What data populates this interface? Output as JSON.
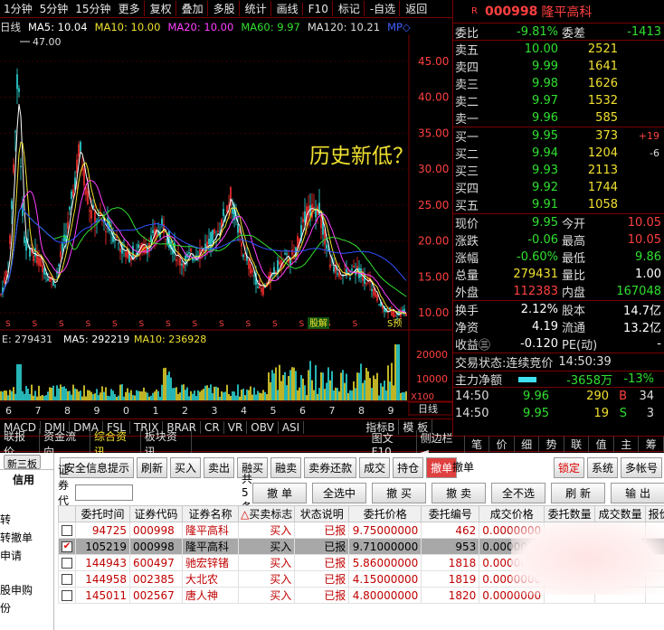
{
  "toolbar": {
    "items": [
      "1分钟",
      "5分钟",
      "15分钟",
      "更多",
      "复权",
      "叠加",
      "多股",
      "统计",
      "画线",
      "F10",
      "标记",
      "-自选",
      "返回"
    ]
  },
  "ma_bar": {
    "period": "日线",
    "ma5": "MA5: 10.04",
    "ma10": "MA10: 10.00",
    "ma20": "MA20: 10.00",
    "ma60": "MA60: 9.97",
    "ma120": "MA120: 10.21",
    "mp": "MP◇"
  },
  "chart": {
    "high_label": "47.00",
    "price_ticks": [
      "45.00",
      "40.00",
      "35.00",
      "30.00",
      "25.00",
      "20.00",
      "15.00",
      "10.00"
    ],
    "annotation": "历史新低？",
    "event_label_1": "股解",
    "event_label_2": "S预",
    "volume_readout": {
      "vol": "E: 279431",
      "ma5": "MA5: 292219",
      "ma10": "MA10: 236928"
    },
    "volume_ticks": [
      "20000",
      "10000"
    ],
    "volume_unit": "X100",
    "x_ticks": [
      "6",
      "7",
      "8",
      "9",
      "0",
      "1",
      "2",
      "3",
      "4",
      "5",
      "6",
      "7",
      "8",
      "9"
    ],
    "period_button": "日线",
    "colors": {
      "up": "#ff3030",
      "down": "#30e0e0",
      "ma5": "#ffffff",
      "ma10": "#f0e030",
      "ma20": "#ff40ff",
      "ma60": "#30e030",
      "ma120": "#40a0ff"
    }
  },
  "indicator_tabs": [
    "MACD",
    "DMI",
    "DMA",
    "FSL",
    "TRIX",
    "BRAR",
    "CR",
    "VR",
    "OBV",
    "ASI",
    "指标B",
    "模 板"
  ],
  "info_tabs": [
    "联报价",
    "资金流向",
    "综合资讯",
    "板块资讯",
    "图文F10",
    "侧边栏◄",
    "笔",
    "价",
    "细",
    "势",
    "联",
    "值",
    "主",
    "筹"
  ],
  "quote": {
    "flag": "R",
    "code": "000998",
    "name": "隆平高科",
    "webi_label": "委比",
    "webi": "-9.81%",
    "weicha_label": "委差",
    "weicha": "-1413",
    "asks": [
      {
        "label": "卖五",
        "price": "10.00",
        "vol": "2521",
        "chg": ""
      },
      {
        "label": "卖四",
        "price": "9.99",
        "vol": "1641",
        "chg": ""
      },
      {
        "label": "卖三",
        "price": "9.98",
        "vol": "1626",
        "chg": ""
      },
      {
        "label": "卖二",
        "price": "9.97",
        "vol": "1532",
        "chg": ""
      },
      {
        "label": "卖一",
        "price": "9.96",
        "vol": "585",
        "chg": ""
      }
    ],
    "bids": [
      {
        "label": "买一",
        "price": "9.95",
        "vol": "373",
        "chg": "+19"
      },
      {
        "label": "买二",
        "price": "9.94",
        "vol": "1204",
        "chg": "-6"
      },
      {
        "label": "买三",
        "price": "9.93",
        "vol": "2113",
        "chg": ""
      },
      {
        "label": "买四",
        "price": "9.92",
        "vol": "1744",
        "chg": ""
      },
      {
        "label": "买五",
        "price": "9.91",
        "vol": "1058",
        "chg": ""
      }
    ],
    "stats": [
      {
        "l1": "现价",
        "v1": "9.95",
        "c1": "grn",
        "l2": "今开",
        "v2": "10.05",
        "c2": "red"
      },
      {
        "l1": "涨跌",
        "v1": "-0.06",
        "c1": "grn",
        "l2": "最高",
        "v2": "10.05",
        "c2": "red"
      },
      {
        "l1": "涨幅",
        "v1": "-0.60%",
        "c1": "grn",
        "l2": "最低",
        "v2": "9.86",
        "c2": "grn"
      },
      {
        "l1": "总量",
        "v1": "279431",
        "c1": "yel",
        "l2": "量比",
        "v2": "1.00",
        "c2": "wht"
      },
      {
        "l1": "外盘",
        "v1": "112383",
        "c1": "red",
        "l2": "内盘",
        "v2": "167048",
        "c2": "grn"
      }
    ],
    "stats2": [
      {
        "l1": "换手",
        "v1": "2.12%",
        "l2": "股本",
        "v2": "14.7亿"
      },
      {
        "l1": "净资",
        "v1": "4.19",
        "l2": "流通",
        "v2": "13.2亿"
      },
      {
        "l1": "收益㊂",
        "v1": "-0.120",
        "l2": "PE(动)",
        "v2": "-"
      }
    ],
    "trade_status_label": "交易状态:",
    "trade_status": "连续竞价",
    "trade_time": "14:50:39",
    "main_flow_label": "主力净额",
    "main_flow": "-3658万",
    "main_flow_pct": "-13%",
    "ticks": [
      {
        "time": "14:50",
        "price": "9.96",
        "vol": "290",
        "side": "B",
        "n": "34"
      },
      {
        "time": "14:50",
        "price": "9.95",
        "vol": "19",
        "side": "S",
        "n": "3"
      }
    ]
  },
  "trade_panel": {
    "left_tabs": [
      "新三板",
      "信用"
    ],
    "left_items": [
      "转",
      "转撤单",
      "申请",
      "股申购",
      "份"
    ],
    "top_buttons": [
      "安全信息提示",
      "刷新",
      "买入",
      "卖出",
      "融买",
      "融卖",
      "卖券还款",
      "成交",
      "持仓",
      "撤单"
    ],
    "active_title": "撤单",
    "right_buttons": [
      "锁定",
      "系统",
      "多帐号"
    ],
    "code_label": "证券代码:",
    "code_value": "",
    "count": "共5条",
    "action_buttons": [
      "撤 单",
      "全选中",
      "撤 买",
      "撤 卖",
      "全不选",
      "刷 新",
      "输 出"
    ],
    "columns": [
      "委托时间",
      "证券代码",
      "证券名称",
      "买卖标志",
      "状态说明",
      "委托价格",
      "委托编号",
      "成交价格",
      "委托数量",
      "成交数量",
      "报价"
    ],
    "rows": [
      {
        "checked": false,
        "time": "94725",
        "code": "000998",
        "name": "隆平高科",
        "side": "买入",
        "status": "已报",
        "price": "9.75000000",
        "no": "462",
        "deal": "0.0000000",
        "qty": "",
        "dqty": ""
      },
      {
        "checked": true,
        "time": "105219",
        "code": "000998",
        "name": "隆平高科",
        "side": "买入",
        "status": "已报",
        "price": "9.71000000",
        "no": "953",
        "deal": "0.0000000",
        "qty": "",
        "dqty": ""
      },
      {
        "checked": false,
        "time": "144943",
        "code": "600497",
        "name": "驰宏锌锗",
        "side": "买入",
        "status": "已报",
        "price": "5.86000000",
        "no": "1818",
        "deal": "0.0000000",
        "qty": "",
        "dqty": ""
      },
      {
        "checked": false,
        "time": "144958",
        "code": "002385",
        "name": "大北农",
        "side": "买入",
        "status": "已报",
        "price": "4.15000000",
        "no": "1819",
        "deal": "0.0000000",
        "qty": "",
        "dqty": ""
      },
      {
        "checked": false,
        "time": "145011",
        "code": "002567",
        "name": "唐人神",
        "side": "买入",
        "status": "已报",
        "price": "4.80000000",
        "no": "1820",
        "deal": "0.0000000",
        "qty": "",
        "dqty": ""
      }
    ]
  }
}
